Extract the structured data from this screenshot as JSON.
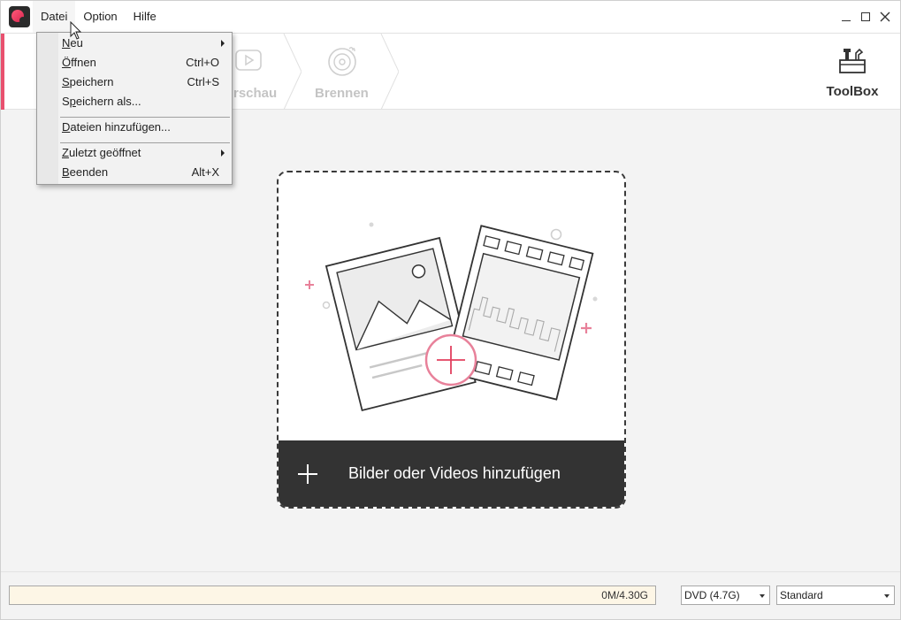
{
  "menubar": {
    "items": [
      "Datei",
      "Option",
      "Hilfe"
    ]
  },
  "toolbar": {
    "steps": [
      {
        "label": "Vorschau",
        "visible_text": "rschau"
      },
      {
        "label": "Brennen"
      }
    ],
    "toolbox_label": "ToolBox"
  },
  "dropdown": {
    "items": [
      {
        "label_u": "N",
        "label_rest": "eu",
        "shortcut": "",
        "submenu": true
      },
      {
        "label_u": "Ö",
        "label_rest": "ffnen",
        "shortcut": "Ctrl+O",
        "submenu": false
      },
      {
        "label_u": "S",
        "label_rest": "peichern",
        "shortcut": "Ctrl+S",
        "submenu": false
      },
      {
        "label_pre": "S",
        "label_u": "p",
        "label_rest": "eichern als...",
        "shortcut": "",
        "submenu": false
      },
      {
        "label_u": "D",
        "label_rest": "ateien hinzufügen...",
        "shortcut": "",
        "submenu": false
      },
      {
        "label_u": "Z",
        "label_rest": "uletzt geöffnet",
        "shortcut": "",
        "submenu": true
      },
      {
        "label_u": "B",
        "label_rest": "eenden",
        "shortcut": "Alt+X",
        "submenu": false
      }
    ]
  },
  "main": {
    "add_media_label": "Bilder oder Videos hinzufügen"
  },
  "statusbar": {
    "capacity_text": "0M/4.30G",
    "capacity_fraction": 0.0,
    "disc_type": "DVD (4.7G)",
    "quality": "Standard"
  },
  "colors": {
    "accent": "#e8506e",
    "dark_bar": "#333333",
    "capacity_bg": "#fdf6e6"
  }
}
